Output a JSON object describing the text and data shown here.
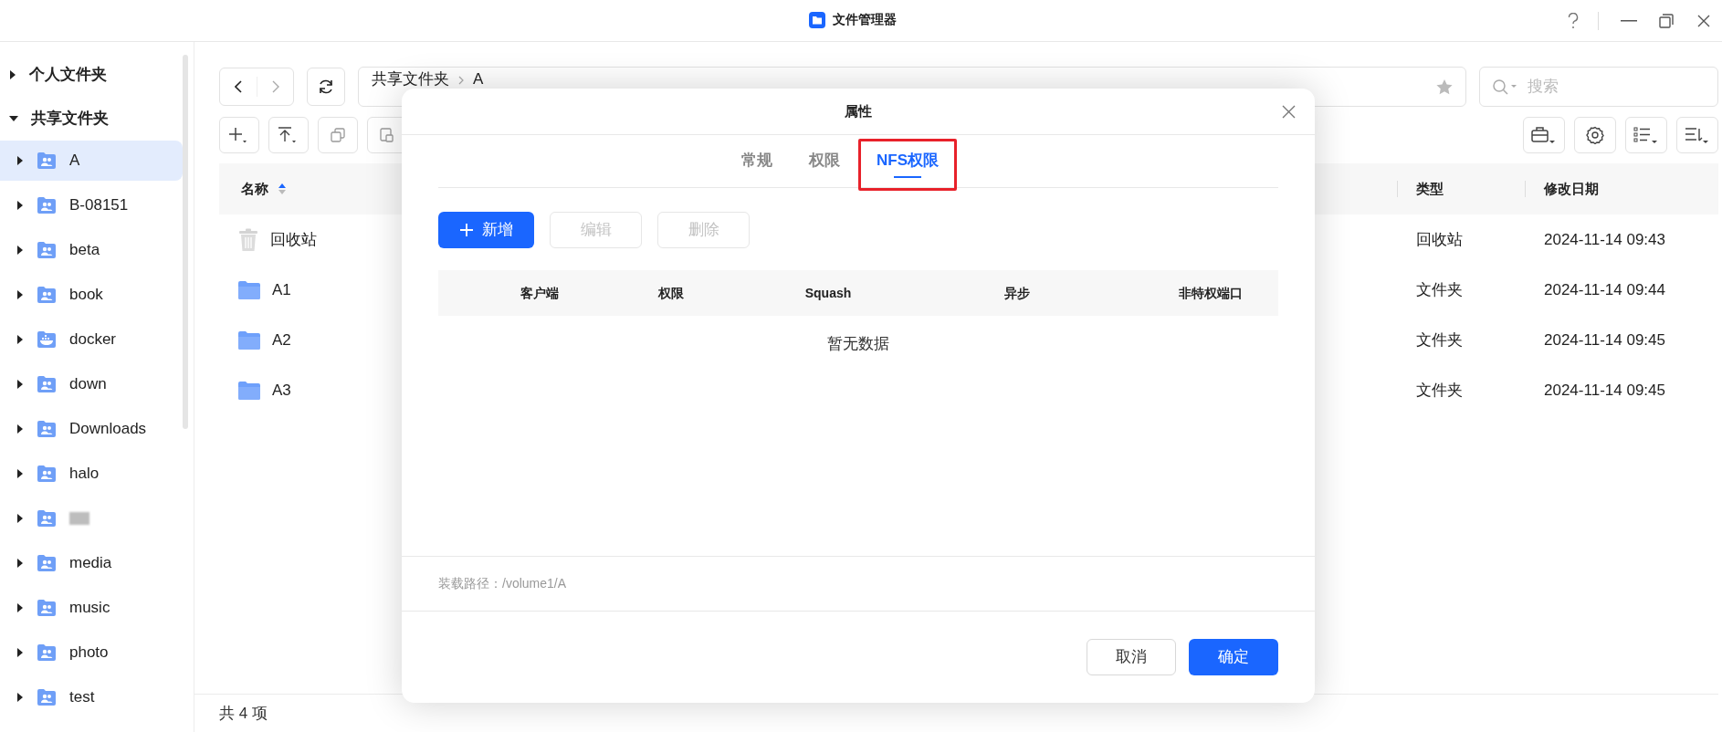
{
  "window": {
    "title": "文件管理器"
  },
  "sidebar": {
    "sections": [
      {
        "label": "个人文件夹",
        "expanded": false
      },
      {
        "label": "共享文件夹",
        "expanded": true
      }
    ],
    "items": [
      {
        "label": "A",
        "kind": "share",
        "selected": true
      },
      {
        "label": "B-08151",
        "kind": "share",
        "selected": false
      },
      {
        "label": "beta",
        "kind": "share",
        "selected": false
      },
      {
        "label": "book",
        "kind": "share",
        "selected": false
      },
      {
        "label": "docker",
        "kind": "docker",
        "selected": false
      },
      {
        "label": "down",
        "kind": "share",
        "selected": false
      },
      {
        "label": "Downloads",
        "kind": "share",
        "selected": false
      },
      {
        "label": "halo",
        "kind": "share",
        "selected": false
      },
      {
        "kind": "redacted",
        "selected": false
      },
      {
        "label": "media",
        "kind": "share",
        "selected": false
      },
      {
        "label": "music",
        "kind": "share",
        "selected": false
      },
      {
        "label": "photo",
        "kind": "share",
        "selected": false
      },
      {
        "label": "test",
        "kind": "share",
        "selected": false
      }
    ]
  },
  "path": {
    "segments": [
      "共享文件夹",
      "A"
    ]
  },
  "search": {
    "placeholder": "搜索"
  },
  "table": {
    "columns": [
      "名称",
      "类型",
      "修改日期"
    ],
    "rows": [
      {
        "name": "回收站",
        "kind": "trash",
        "type": "回收站",
        "modified": "2024-11-14 09:43"
      },
      {
        "name": "A1",
        "kind": "folder",
        "type": "文件夹",
        "modified": "2024-11-14 09:44"
      },
      {
        "name": "A2",
        "kind": "folder",
        "type": "文件夹",
        "modified": "2024-11-14 09:45"
      },
      {
        "name": "A3",
        "kind": "folder",
        "type": "文件夹",
        "modified": "2024-11-14 09:45"
      }
    ]
  },
  "status_bar": "共 4 项",
  "dialog": {
    "title": "属性",
    "tabs": [
      {
        "label": "常规",
        "selected": false
      },
      {
        "label": "权限",
        "selected": false
      },
      {
        "label": "NFS权限",
        "selected": true,
        "highlighted": true
      }
    ],
    "buttons": [
      {
        "label": "新增",
        "kind": "primary",
        "disabled": false
      },
      {
        "label": "编辑",
        "kind": "default",
        "disabled": true
      },
      {
        "label": "删除",
        "kind": "default",
        "disabled": true
      }
    ],
    "columns": [
      "客户端",
      "权限",
      "Squash",
      "异步",
      "非特权端口"
    ],
    "empty_text": "暂无数据",
    "mount_path": "装载路径：/volume1/A",
    "footer_buttons": [
      {
        "label": "取消",
        "kind": "default"
      },
      {
        "label": "确定",
        "kind": "primary"
      }
    ]
  }
}
